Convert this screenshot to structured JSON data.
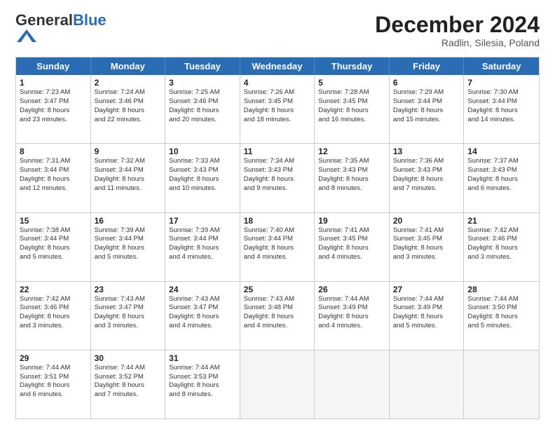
{
  "header": {
    "logo": {
      "general": "General",
      "blue": "Blue"
    },
    "title": "December 2024",
    "location": "Radlin, Silesia, Poland"
  },
  "days_of_week": [
    "Sunday",
    "Monday",
    "Tuesday",
    "Wednesday",
    "Thursday",
    "Friday",
    "Saturday"
  ],
  "weeks": [
    [
      {
        "day": "1",
        "info": "Sunrise: 7:23 AM\nSunset: 3:47 PM\nDaylight: 8 hours\nand 23 minutes."
      },
      {
        "day": "2",
        "info": "Sunrise: 7:24 AM\nSunset: 3:46 PM\nDaylight: 8 hours\nand 22 minutes."
      },
      {
        "day": "3",
        "info": "Sunrise: 7:25 AM\nSunset: 3:46 PM\nDaylight: 8 hours\nand 20 minutes."
      },
      {
        "day": "4",
        "info": "Sunrise: 7:26 AM\nSunset: 3:45 PM\nDaylight: 8 hours\nand 18 minutes."
      },
      {
        "day": "5",
        "info": "Sunrise: 7:28 AM\nSunset: 3:45 PM\nDaylight: 8 hours\nand 16 minutes."
      },
      {
        "day": "6",
        "info": "Sunrise: 7:29 AM\nSunset: 3:44 PM\nDaylight: 8 hours\nand 15 minutes."
      },
      {
        "day": "7",
        "info": "Sunrise: 7:30 AM\nSunset: 3:44 PM\nDaylight: 8 hours\nand 14 minutes."
      }
    ],
    [
      {
        "day": "8",
        "info": "Sunrise: 7:31 AM\nSunset: 3:44 PM\nDaylight: 8 hours\nand 12 minutes."
      },
      {
        "day": "9",
        "info": "Sunrise: 7:32 AM\nSunset: 3:44 PM\nDaylight: 8 hours\nand 11 minutes."
      },
      {
        "day": "10",
        "info": "Sunrise: 7:33 AM\nSunset: 3:43 PM\nDaylight: 8 hours\nand 10 minutes."
      },
      {
        "day": "11",
        "info": "Sunrise: 7:34 AM\nSunset: 3:43 PM\nDaylight: 8 hours\nand 9 minutes."
      },
      {
        "day": "12",
        "info": "Sunrise: 7:35 AM\nSunset: 3:43 PM\nDaylight: 8 hours\nand 8 minutes."
      },
      {
        "day": "13",
        "info": "Sunrise: 7:36 AM\nSunset: 3:43 PM\nDaylight: 8 hours\nand 7 minutes."
      },
      {
        "day": "14",
        "info": "Sunrise: 7:37 AM\nSunset: 3:43 PM\nDaylight: 8 hours\nand 6 minutes."
      }
    ],
    [
      {
        "day": "15",
        "info": "Sunrise: 7:38 AM\nSunset: 3:44 PM\nDaylight: 8 hours\nand 5 minutes."
      },
      {
        "day": "16",
        "info": "Sunrise: 7:39 AM\nSunset: 3:44 PM\nDaylight: 8 hours\nand 5 minutes."
      },
      {
        "day": "17",
        "info": "Sunrise: 7:39 AM\nSunset: 3:44 PM\nDaylight: 8 hours\nand 4 minutes."
      },
      {
        "day": "18",
        "info": "Sunrise: 7:40 AM\nSunset: 3:44 PM\nDaylight: 8 hours\nand 4 minutes."
      },
      {
        "day": "19",
        "info": "Sunrise: 7:41 AM\nSunset: 3:45 PM\nDaylight: 8 hours\nand 4 minutes."
      },
      {
        "day": "20",
        "info": "Sunrise: 7:41 AM\nSunset: 3:45 PM\nDaylight: 8 hours\nand 3 minutes."
      },
      {
        "day": "21",
        "info": "Sunrise: 7:42 AM\nSunset: 3:46 PM\nDaylight: 8 hours\nand 3 minutes."
      }
    ],
    [
      {
        "day": "22",
        "info": "Sunrise: 7:42 AM\nSunset: 3:46 PM\nDaylight: 8 hours\nand 3 minutes."
      },
      {
        "day": "23",
        "info": "Sunrise: 7:43 AM\nSunset: 3:47 PM\nDaylight: 8 hours\nand 3 minutes."
      },
      {
        "day": "24",
        "info": "Sunrise: 7:43 AM\nSunset: 3:47 PM\nDaylight: 8 hours\nand 4 minutes."
      },
      {
        "day": "25",
        "info": "Sunrise: 7:43 AM\nSunset: 3:48 PM\nDaylight: 8 hours\nand 4 minutes."
      },
      {
        "day": "26",
        "info": "Sunrise: 7:44 AM\nSunset: 3:49 PM\nDaylight: 8 hours\nand 4 minutes."
      },
      {
        "day": "27",
        "info": "Sunrise: 7:44 AM\nSunset: 3:49 PM\nDaylight: 8 hours\nand 5 minutes."
      },
      {
        "day": "28",
        "info": "Sunrise: 7:44 AM\nSunset: 3:50 PM\nDaylight: 8 hours\nand 5 minutes."
      }
    ],
    [
      {
        "day": "29",
        "info": "Sunrise: 7:44 AM\nSunset: 3:51 PM\nDaylight: 8 hours\nand 6 minutes."
      },
      {
        "day": "30",
        "info": "Sunrise: 7:44 AM\nSunset: 3:52 PM\nDaylight: 8 hours\nand 7 minutes."
      },
      {
        "day": "31",
        "info": "Sunrise: 7:44 AM\nSunset: 3:53 PM\nDaylight: 8 hours\nand 8 minutes."
      },
      {
        "day": "",
        "info": ""
      },
      {
        "day": "",
        "info": ""
      },
      {
        "day": "",
        "info": ""
      },
      {
        "day": "",
        "info": ""
      }
    ]
  ]
}
